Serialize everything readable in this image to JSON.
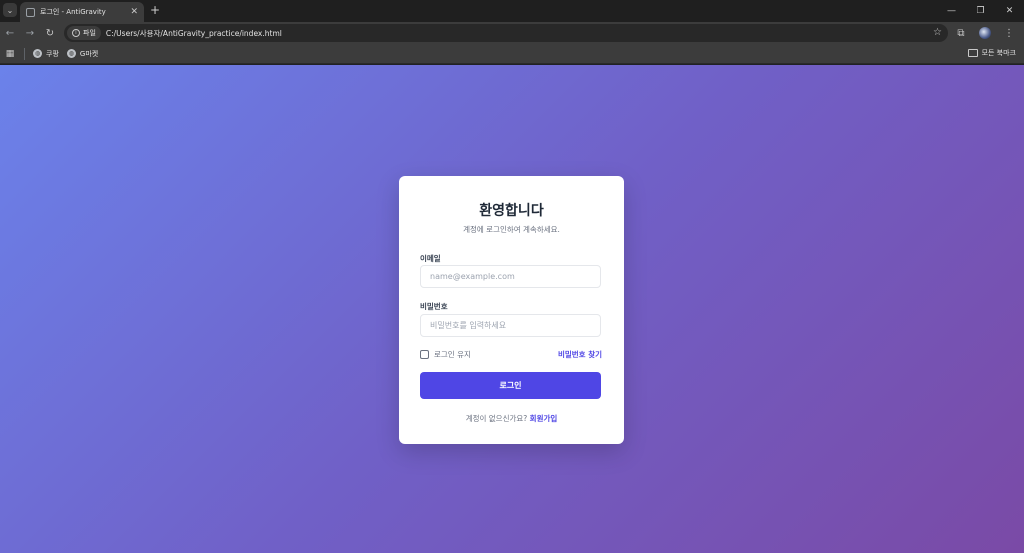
{
  "browser": {
    "tab_title": "로그인 - AntiGravity",
    "tab_close": "✕",
    "new_tab": "+",
    "site_chip_label": "파일",
    "url": "C:/Users/사용자/AntiGravity_practice/index.html",
    "bookmarks": [
      {
        "label": "쿠팡"
      },
      {
        "label": "G마켓"
      }
    ],
    "all_bookmarks_label": "모든 북마크"
  },
  "login": {
    "title": "환영합니다",
    "subtitle": "계정에 로그인하여 계속하세요.",
    "email_label": "이메일",
    "email_placeholder": "name@example.com",
    "password_label": "비밀번호",
    "password_placeholder": "비밀번호를 입력하세요",
    "remember_label": "로그인 유지",
    "forgot_label": "비밀번호 찾기",
    "submit_label": "로그인",
    "no_account_text": "계정이 없으신가요?",
    "signup_label": "회원가입"
  },
  "colors": {
    "accent": "#4f46e5",
    "gradient_start": "#6b82ea",
    "gradient_end": "#7a4aa6"
  }
}
